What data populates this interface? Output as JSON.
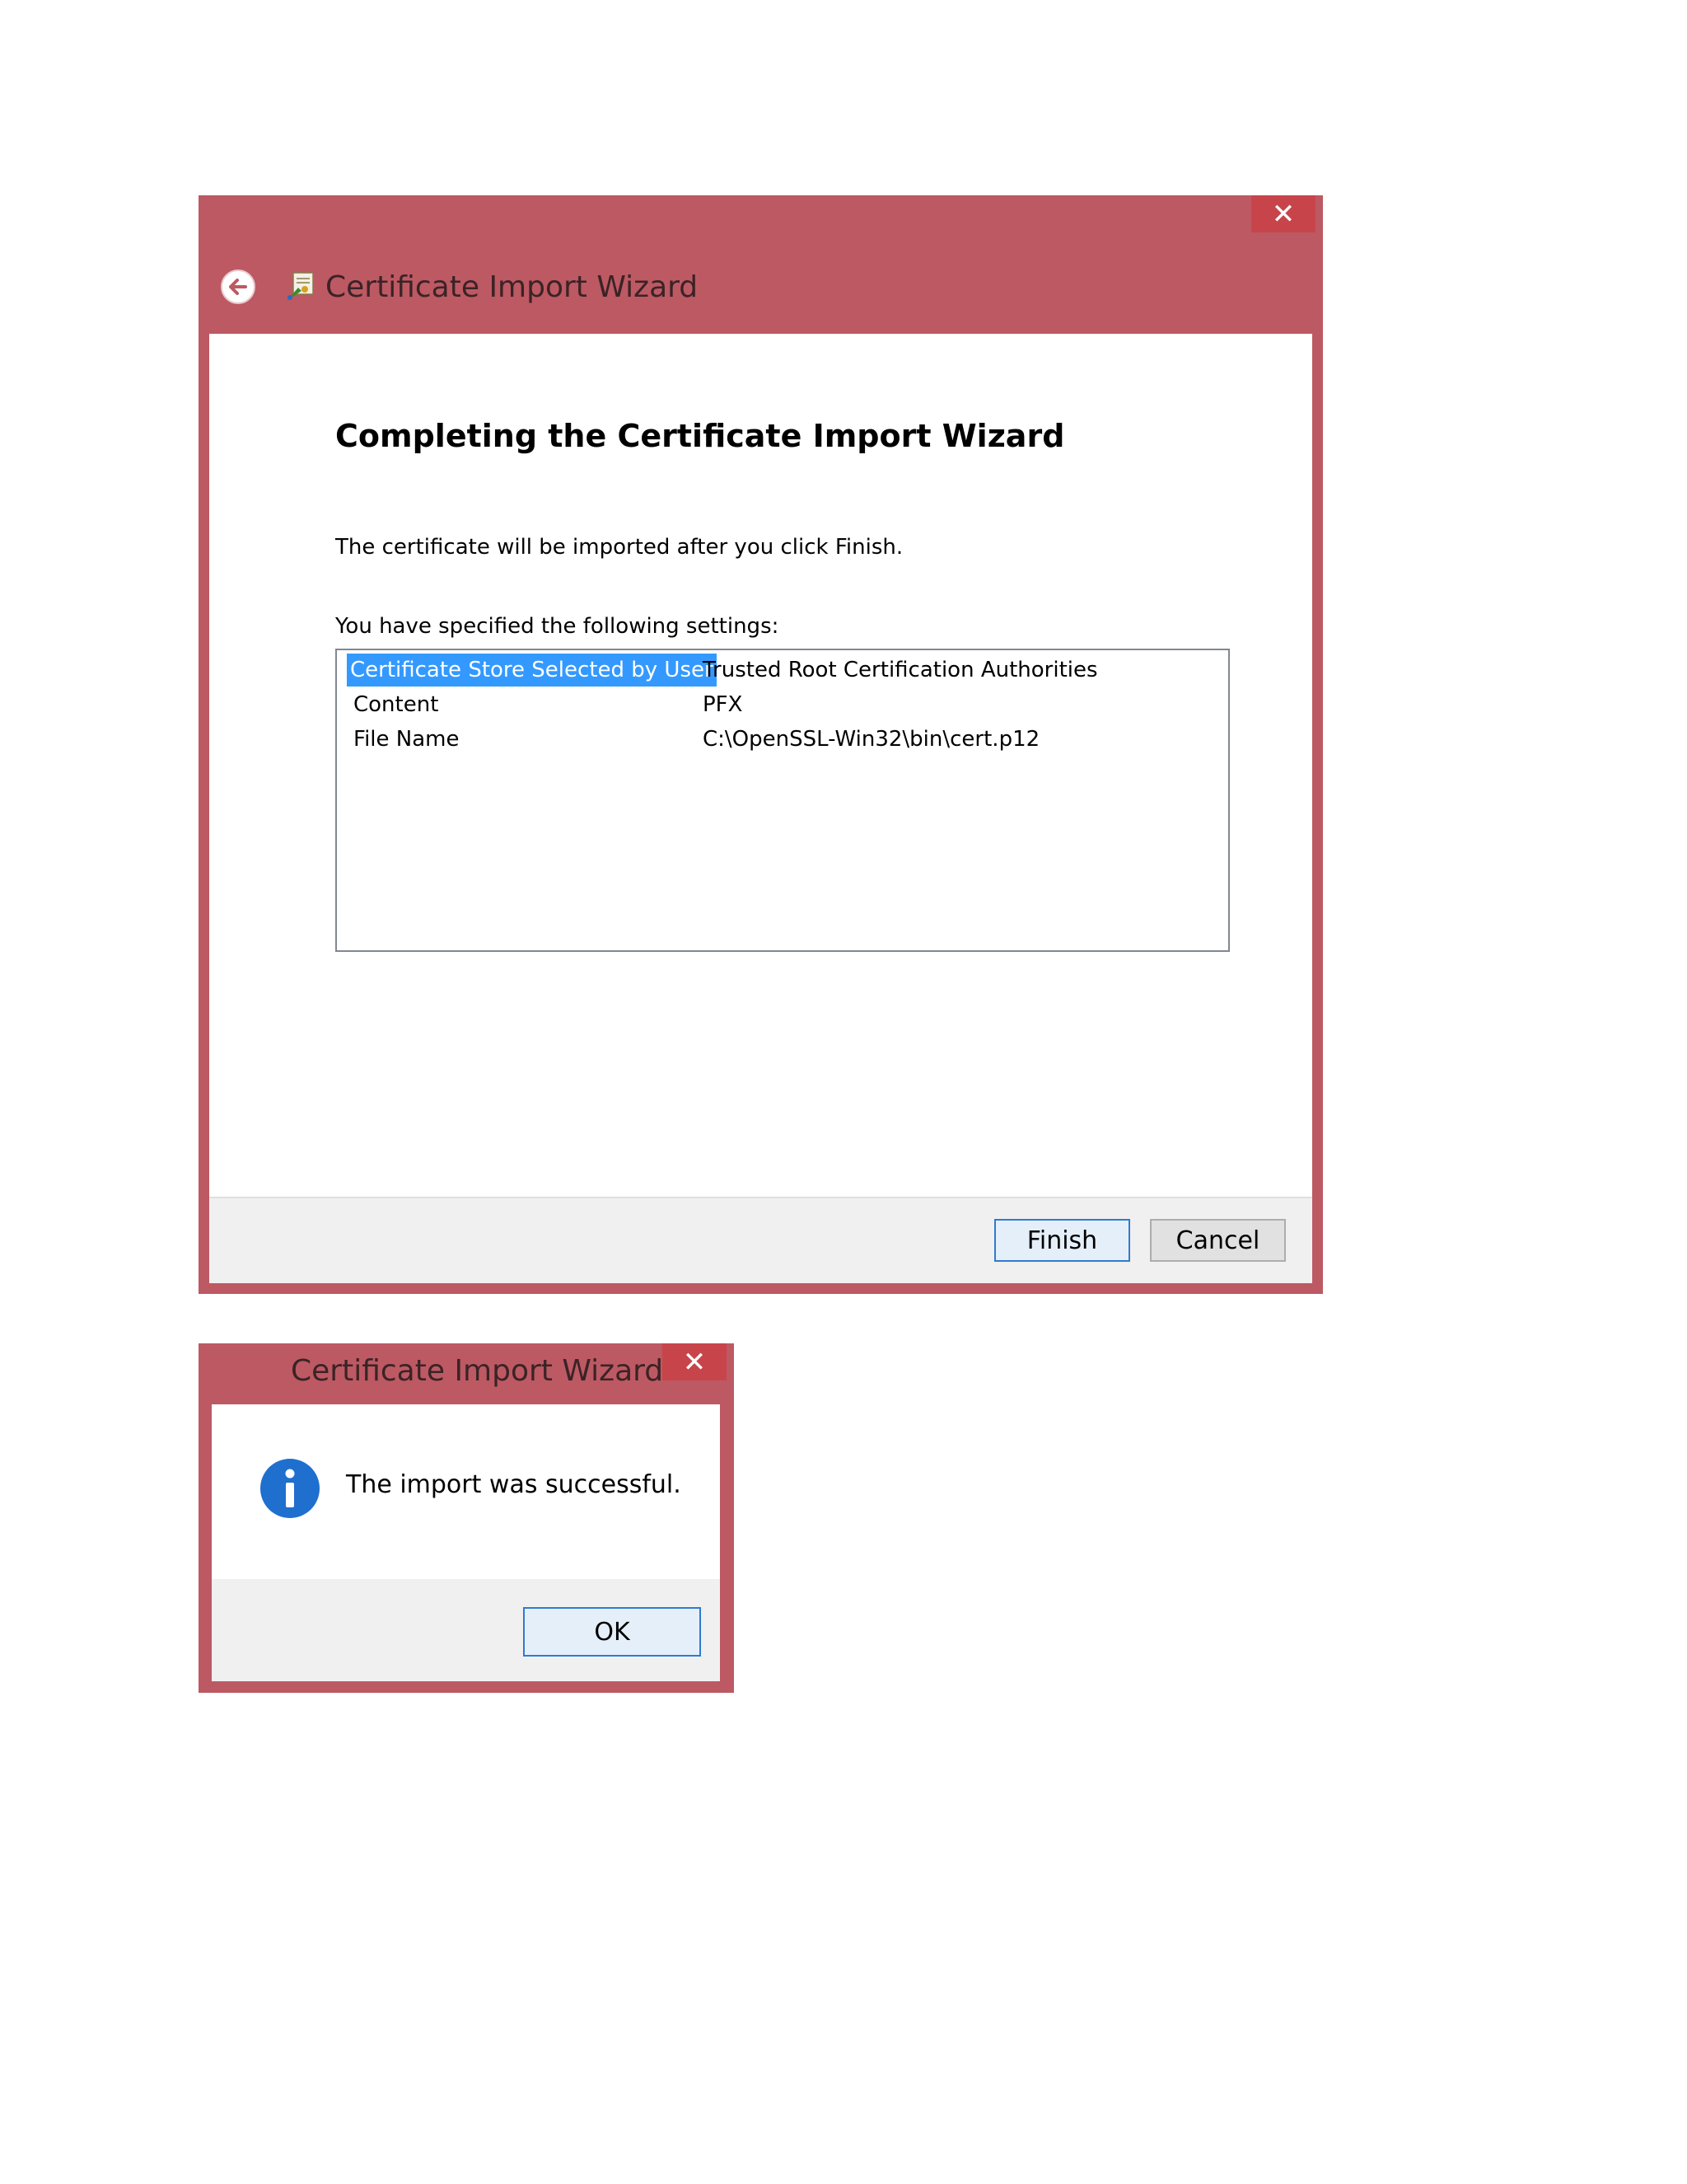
{
  "wizard": {
    "title": "Certificate Import Wizard",
    "close_glyph": "✕",
    "heading": "Completing the Certificate Import Wizard",
    "info_text": "The certificate will be imported after you click Finish.",
    "settings_label": "You have specified the following settings:",
    "settings": [
      {
        "key": "Certificate Store Selected by User",
        "value": "Trusted Root Certification Authorities",
        "selected": true
      },
      {
        "key": "Content",
        "value": "PFX"
      },
      {
        "key": "File Name",
        "value": "C:\\OpenSSL-Win32\\bin\\cert.p12"
      }
    ],
    "finish_label": "Finish",
    "cancel_label": "Cancel"
  },
  "msgbox": {
    "title": "Certificate Import Wizard",
    "close_glyph": "✕",
    "message": "The import was successful.",
    "ok_label": "OK",
    "icon": "info-icon"
  },
  "colors": {
    "frame": "#bd5963",
    "close_button": "#c8444b",
    "selection": "#3399ff",
    "default_button_border": "#2e7bd1"
  }
}
